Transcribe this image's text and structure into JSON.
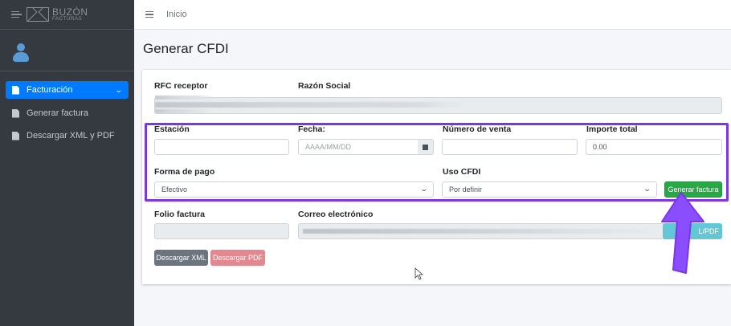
{
  "brand": {
    "line1": "BUZÓN",
    "line2": "FACTURAS"
  },
  "sidebar": {
    "items": [
      {
        "label": "Facturación",
        "icon": "document-icon",
        "active": true
      },
      {
        "label": "Generar factura",
        "icon": "document-icon",
        "active": false
      },
      {
        "label": "Descargar XML y PDF",
        "icon": "download-document-icon",
        "active": false
      }
    ]
  },
  "topbar": {
    "home_link": "Inicio"
  },
  "page": {
    "title": "Generar CFDI"
  },
  "form": {
    "rfc_label": "RFC receptor",
    "razon_label": "Razón Social",
    "estacion_label": "Estación",
    "fecha_label": "Fecha:",
    "fecha_placeholder": "AAAA/MM/DD",
    "venta_label": "Número de venta",
    "importe_label": "Importe total",
    "importe_value": "0.00",
    "forma_pago_label": "Forma de pago",
    "forma_pago_value": "Efectivo",
    "uso_cfdi_label": "Uso CFDI",
    "uso_cfdi_value": "Por definir",
    "generar_button": "Generar factura",
    "folio_label": "Folio factura",
    "correo_label": "Correo electrónico",
    "enviar_button_partial": "L/PDF",
    "descargar_xml_button": "Descargar XML",
    "descargar_pdf_button": "Descargar PDF"
  },
  "colors": {
    "sidebar_bg": "#343a40",
    "active_nav": "#007bff",
    "highlight_border": "#7b36e6",
    "annotation_arrow": "#8a4dff",
    "generate_button": "#28a745"
  }
}
